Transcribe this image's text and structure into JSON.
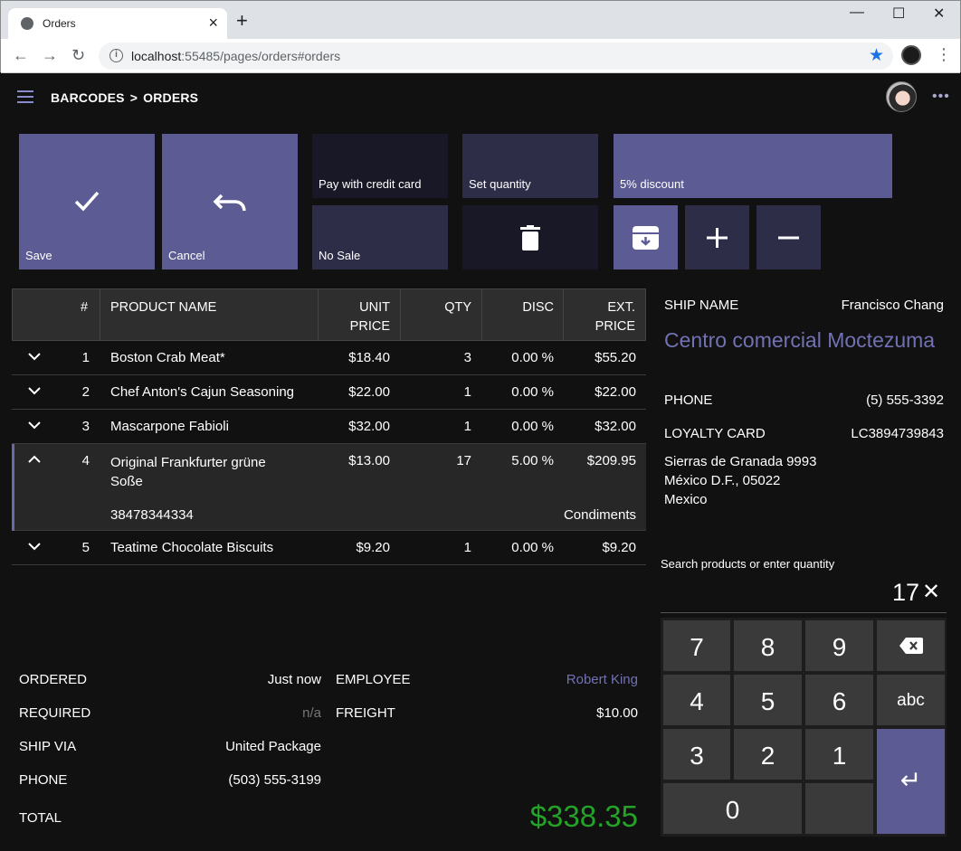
{
  "browser": {
    "tab_title": "Orders",
    "tab_close": "×",
    "new_tab": "+",
    "url_host": "localhost",
    "url_rest": ":55485/pages/orders#orders",
    "controls": {
      "minimize": "—",
      "maximize": "☐",
      "close": "✕"
    }
  },
  "header": {
    "crumb1": "BARCODES",
    "crumb_sep": ">",
    "crumb2": "ORDERS",
    "more": "•••"
  },
  "actions": {
    "save": "Save",
    "cancel": "Cancel",
    "pay_credit": "Pay with credit card",
    "set_quantity": "Set quantity",
    "discount": "5% discount",
    "no_sale": "No Sale"
  },
  "grid": {
    "headers": {
      "num": "#",
      "product": "PRODUCT NAME",
      "unit_price_1": "UNIT",
      "unit_price_2": "PRICE",
      "qty": "QTY",
      "disc": "DISC",
      "ext_1": "EXT.",
      "ext_2": "PRICE"
    },
    "rows": [
      {
        "num": "1",
        "name": "Boston Crab Meat*",
        "price": "$18.40",
        "qty": "3",
        "disc": "0.00 %",
        "ext": "$55.20"
      },
      {
        "num": "2",
        "name": "Chef Anton's Cajun Seasoning",
        "price": "$22.00",
        "qty": "1",
        "disc": "0.00 %",
        "ext": "$22.00"
      },
      {
        "num": "3",
        "name": "Mascarpone Fabioli",
        "price": "$32.00",
        "qty": "1",
        "disc": "0.00 %",
        "ext": "$32.00"
      },
      {
        "num": "4",
        "name_1": "Original Frankfurter grüne",
        "name_2": "Soße",
        "price": "$13.00",
        "qty": "17",
        "disc": "5.00 %",
        "ext": "$209.95",
        "barcode": "38478344334",
        "category": "Condiments"
      },
      {
        "num": "5",
        "name": "Teatime Chocolate Biscuits",
        "price": "$9.20",
        "qty": "1",
        "disc": "0.00 %",
        "ext": "$9.20"
      }
    ]
  },
  "summary": {
    "ordered_label": "ORDERED",
    "ordered_value": "Just now",
    "required_label": "REQUIRED",
    "required_value": "n/a",
    "ship_via_label": "SHIP VIA",
    "ship_via_value": "United Package",
    "phone_label": "PHONE",
    "phone_value": "(503) 555-3199",
    "total_label": "TOTAL",
    "total_value": "$338.35",
    "employee_label": "EMPLOYEE",
    "employee_value": "Robert King",
    "freight_label": "FREIGHT",
    "freight_value": "$10.00"
  },
  "customer": {
    "ship_name_label": "SHIP NAME",
    "ship_name_value": "Francisco Chang",
    "company": "Centro comercial Moctezuma",
    "phone_label": "PHONE",
    "phone_value": "(5) 555-3392",
    "loyalty_label": "LOYALTY CARD",
    "loyalty_value": "LC3894739843",
    "address_1": "Sierras de Granada 9993",
    "address_2": "México D.F., 05022",
    "address_3": "Mexico"
  },
  "search": {
    "label": "Search products or enter quantity",
    "value": "17",
    "clear": "✕"
  },
  "keypad": {
    "k7": "7",
    "k8": "8",
    "k9": "9",
    "k4": "4",
    "k5": "5",
    "k6": "6",
    "abc": "abc",
    "k3": "3",
    "k2": "2",
    "k1": "1",
    "k0": "0",
    "enter": "↵"
  },
  "colors": {
    "accent": "#5c5b93",
    "link": "#7271b4",
    "total": "#24a328",
    "background": "#111111"
  }
}
